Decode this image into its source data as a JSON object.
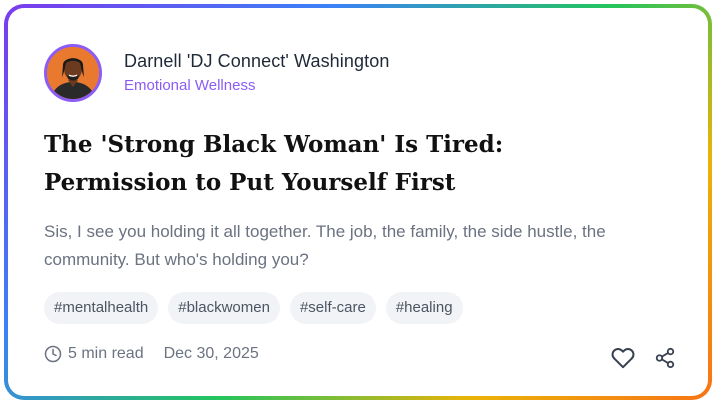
{
  "author": {
    "name": "Darnell 'DJ Connect' Washington",
    "category": "Emotional Wellness"
  },
  "post": {
    "title_line1": "The 'Strong Black Woman' Is Tired:",
    "title_line2": "Permission to Put Yourself First",
    "excerpt": "Sis, I see you holding it all together. The job, the family, the side hustle, the community. But who's holding you?"
  },
  "tags": [
    "#mentalhealth",
    "#blackwomen",
    "#self-care",
    "#healing"
  ],
  "meta": {
    "read_time": "5 min read",
    "date": "Dec 30, 2025"
  },
  "icons": {
    "clock": "clock-icon",
    "like": "heart-icon",
    "share": "share-icon"
  },
  "colors": {
    "accent": "#8b5cf6",
    "title": "#111111",
    "body_text": "#6b7280",
    "tag_bg": "#f1f3f6",
    "border_gradient": [
      "#7c3aed",
      "#3b82f6",
      "#22c55e",
      "#eab308",
      "#f97316"
    ]
  }
}
